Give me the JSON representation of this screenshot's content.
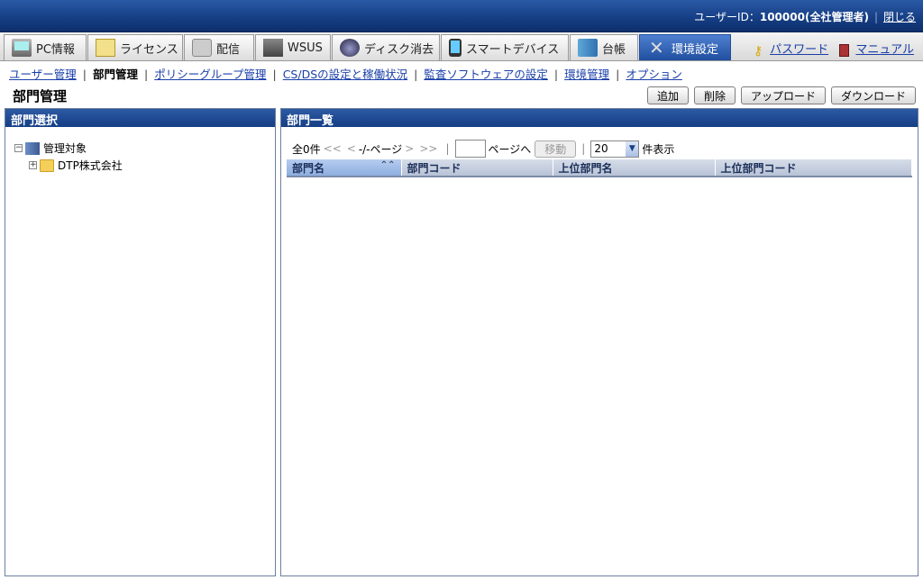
{
  "header": {
    "user_label": "ユーザーID：",
    "user_id": "100000",
    "user_role": "(全社管理者)",
    "close_label": "閉じる"
  },
  "main_tabs": [
    {
      "label": "PC情報",
      "icon": "pc-icon"
    },
    {
      "label": "ライセンス",
      "icon": "license-icon"
    },
    {
      "label": "配信",
      "icon": "distribution-icon"
    },
    {
      "label": "WSUS",
      "icon": "wsus-icon"
    },
    {
      "label": "ディスク消去",
      "icon": "disk-erase-icon"
    },
    {
      "label": "スマートデバイス",
      "icon": "smart-device-icon"
    },
    {
      "label": "台帳",
      "icon": "ledger-icon"
    },
    {
      "label": "環境設定",
      "icon": "tools-icon",
      "active": true
    }
  ],
  "top_links": {
    "password": "パスワード",
    "manual": "マニュアル"
  },
  "sub_nav": [
    "ユーザー管理",
    "部門管理",
    "ポリシーグループ管理",
    "CS/DSの設定と稼働状況",
    "監査ソフトウェアの設定",
    "環境管理",
    "オプション"
  ],
  "page": {
    "title": "部門管理",
    "buttons": {
      "add": "追加",
      "delete": "削除",
      "upload": "アップロード",
      "download": "ダウンロード"
    }
  },
  "left_panel": {
    "title": "部門選択",
    "tree": {
      "root": "管理対象",
      "child": "DTP株式会社"
    }
  },
  "right_panel": {
    "title": "部門一覧",
    "pager": {
      "total": "全0件",
      "first": "<<",
      "prev": "<",
      "page_info": "-/-ページ",
      "next": ">",
      "last": ">>",
      "goto_label": "ページへ",
      "move_button": "移動",
      "per_page_value": "20",
      "per_page_label": "件表示"
    },
    "columns": [
      "部門名",
      "部門コード",
      "上位部門名",
      "上位部門コード"
    ]
  },
  "colors": {
    "header_blue": "#163f86",
    "active_tab": "#1f4f9e",
    "link": "#1a3fa8"
  }
}
